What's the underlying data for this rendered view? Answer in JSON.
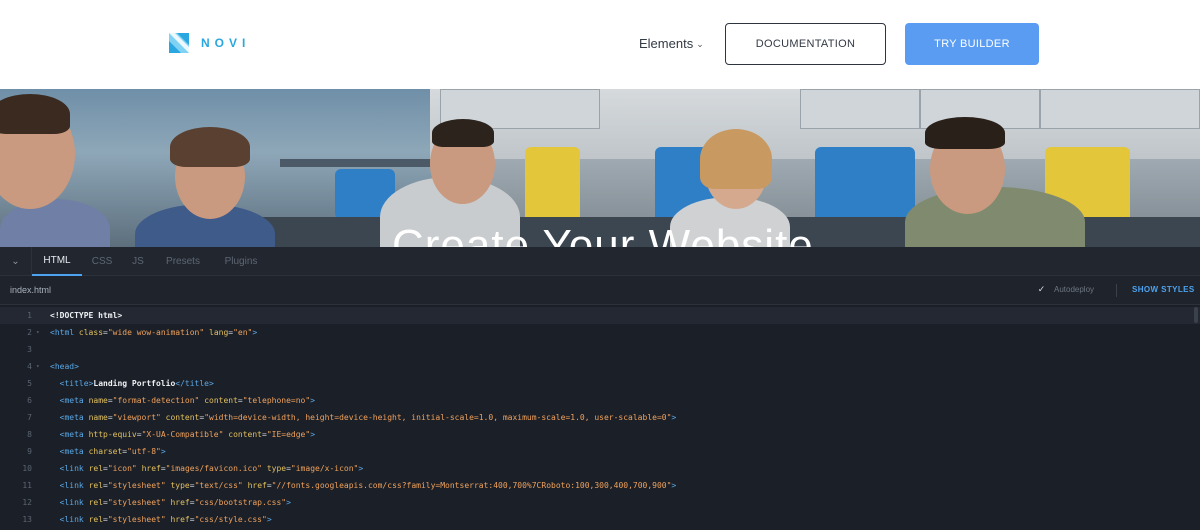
{
  "header": {
    "logo_text": "NOVI",
    "nav": {
      "elements_label": "Elements"
    },
    "buttons": {
      "documentation": "DOCUMENTATION",
      "try_builder": "TRY BUILDER"
    }
  },
  "hero": {
    "title": "Create Your Website"
  },
  "editor": {
    "tabs": [
      "HTML",
      "CSS",
      "JS",
      "Presets",
      "Plugins"
    ],
    "active_tab": "HTML",
    "file_name": "index.html",
    "autodeploy_label": "Autodeploy",
    "autodeploy_checked": true,
    "show_styles_label": "SHOW STYLES",
    "code_lines": [
      "<!DOCTYPE html>",
      "<html class=\"wide wow-animation\" lang=\"en\">",
      "",
      "<head>",
      "  <title>Landing Portfolio</title>",
      "  <meta name=\"format-detection\" content=\"telephone=no\">",
      "  <meta name=\"viewport\" content=\"width=device-width, height=device-height, initial-scale=1.0, maximum-scale=1.0, user-scalable=0\">",
      "  <meta http-equiv=\"X-UA-Compatible\" content=\"IE=edge\">",
      "  <meta charset=\"utf-8\">",
      "  <link rel=\"icon\" href=\"images/favicon.ico\" type=\"image/x-icon\">",
      "  <link rel=\"stylesheet\" type=\"text/css\" href=\"//fonts.googleapis.com/css?family=Montserrat:400,700%7CRoboto:100,300,400,700,900\">",
      "  <link rel=\"stylesheet\" href=\"css/bootstrap.css\">",
      "  <link rel=\"stylesheet\" href=\"css/style.css\">"
    ],
    "foldable_lines": [
      2,
      4
    ]
  },
  "colors": {
    "accent": "#5a9cf2",
    "logo": "#2aa7e0",
    "editor_bg": "#1b1f27",
    "tag": "#5aa8e6",
    "attr": "#e2c15f",
    "string": "#f0a25c"
  },
  "icons": {
    "logo": "novi-logo-mark",
    "chevron": "chevron-down-icon",
    "toggle": "chevron-down-icon",
    "checkbox": "checkmark-icon"
  }
}
